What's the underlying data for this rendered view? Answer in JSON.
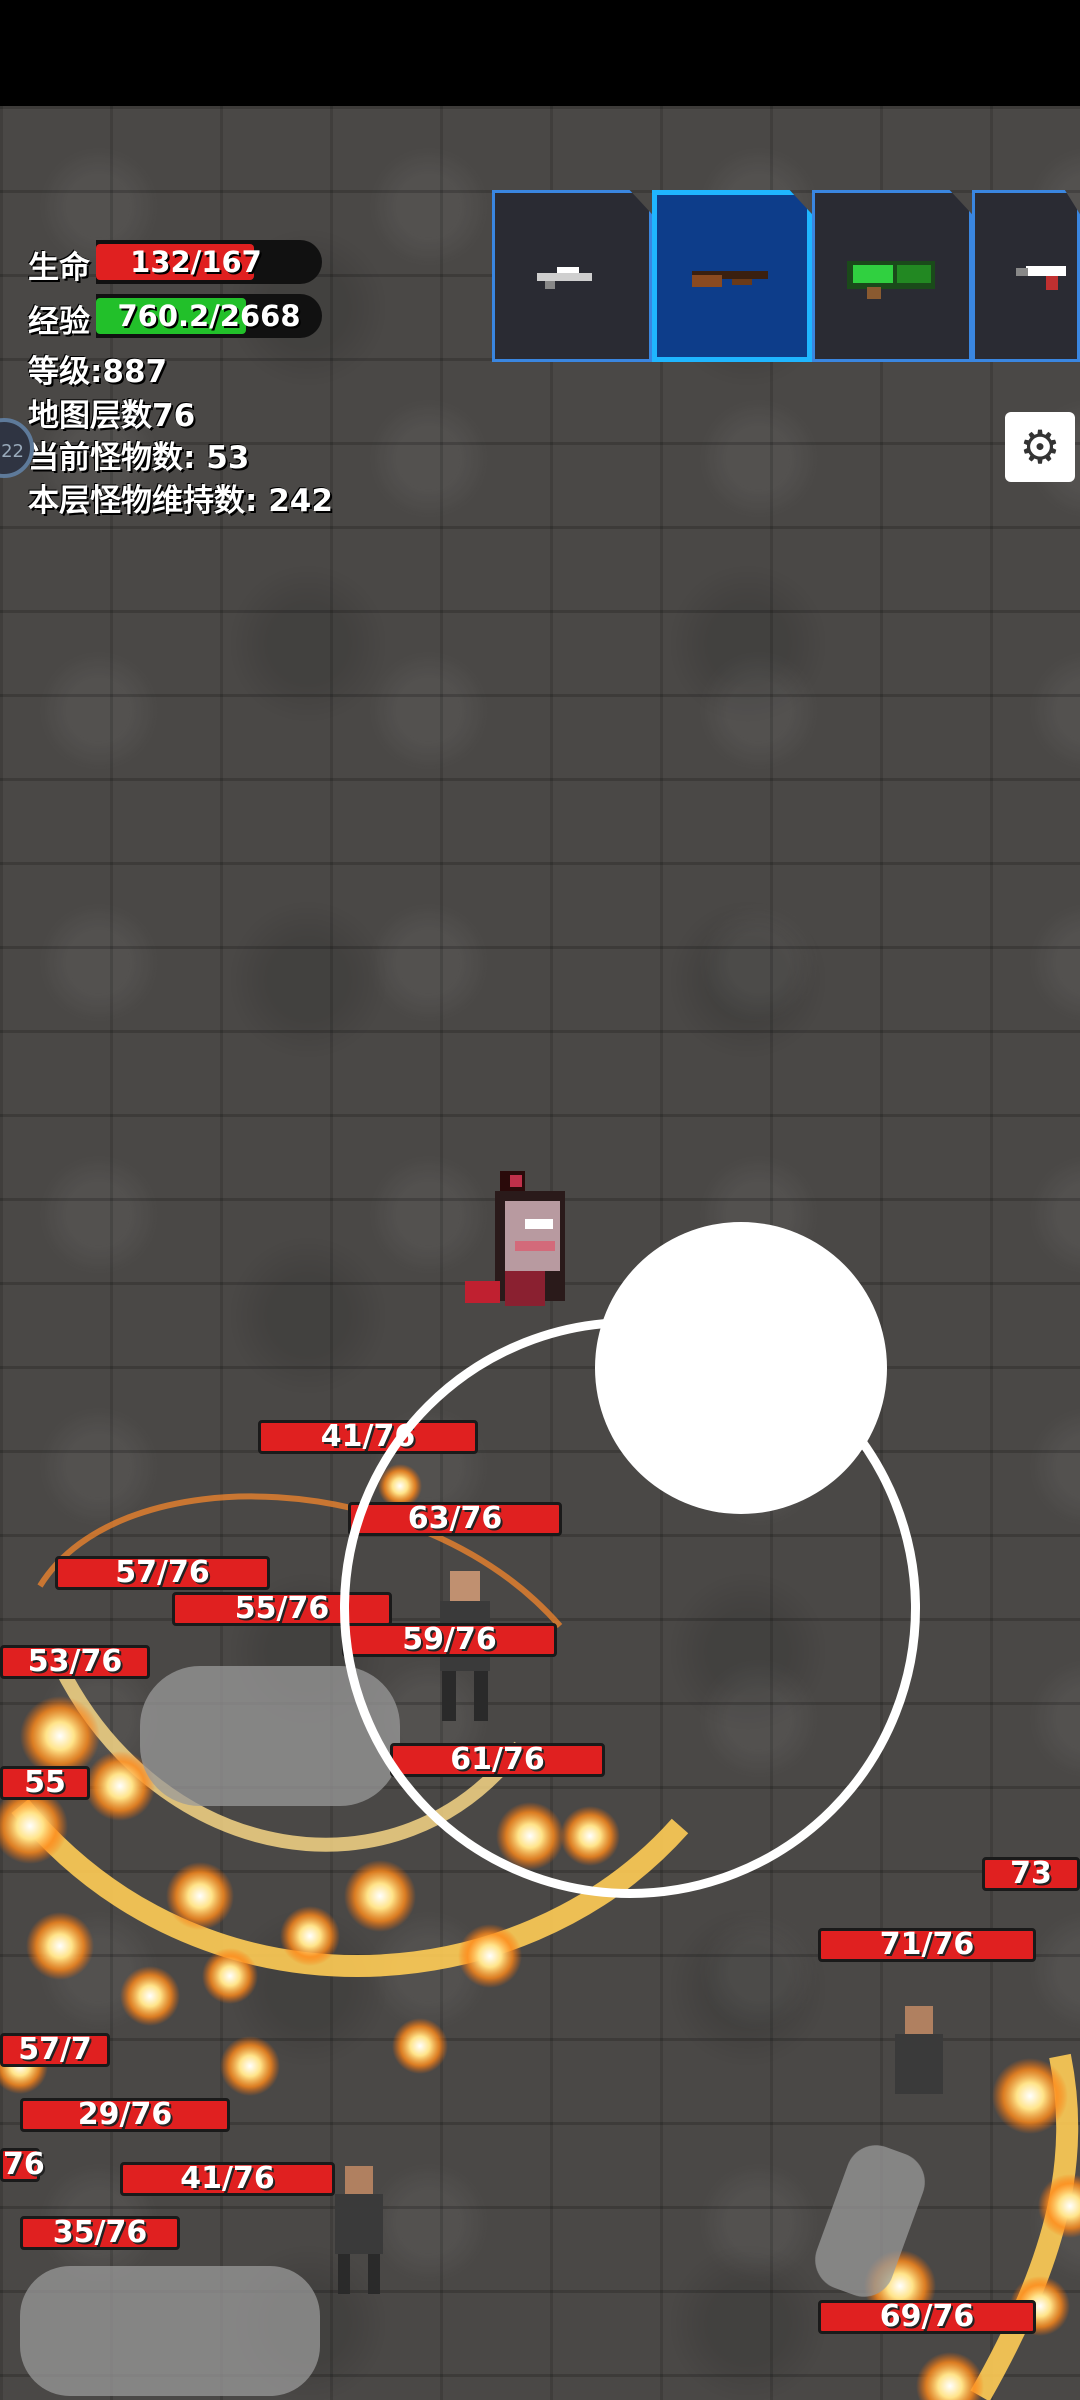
{
  "hud": {
    "life_label": "生命",
    "life_value": "132/167",
    "life_current": 132,
    "life_max": 167,
    "exp_label": "经验",
    "exp_value": "760.2/2668",
    "exp_current": 760.2,
    "exp_max": 2668,
    "level_text": "等级:887",
    "map_layer_text": "地图层数76",
    "current_monsters_text": "当前怪物数: 53",
    "layer_monsters_text": "本层怪物维持数: 242",
    "edge_badge_text": "22"
  },
  "weapons": [
    {
      "name": "rifle-icon",
      "active": false
    },
    {
      "name": "shotgun-icon",
      "active": true
    },
    {
      "name": "green-launcher-icon",
      "active": false
    },
    {
      "name": "pistol-icon",
      "active": false
    }
  ],
  "settings_icon": "gear-icon",
  "enemy_health_bars": [
    {
      "label": "41/76"
    },
    {
      "label": "63/76"
    },
    {
      "label": "57/76"
    },
    {
      "label": "55/76"
    },
    {
      "label": "59/76"
    },
    {
      "label": "53/76"
    },
    {
      "label": "61/76"
    },
    {
      "label": "73"
    },
    {
      "label": "71/76"
    },
    {
      "label": "29/76"
    },
    {
      "label": "41/76"
    },
    {
      "label": "35/76"
    },
    {
      "label": "69/76"
    },
    {
      "label": "57/7"
    },
    {
      "label": "55"
    },
    {
      "label": "76"
    }
  ],
  "colors": {
    "health": "#e02020",
    "exp": "#22c02a",
    "weapon_border": "#3a86e0",
    "weapon_active": "#1fb6ff"
  }
}
